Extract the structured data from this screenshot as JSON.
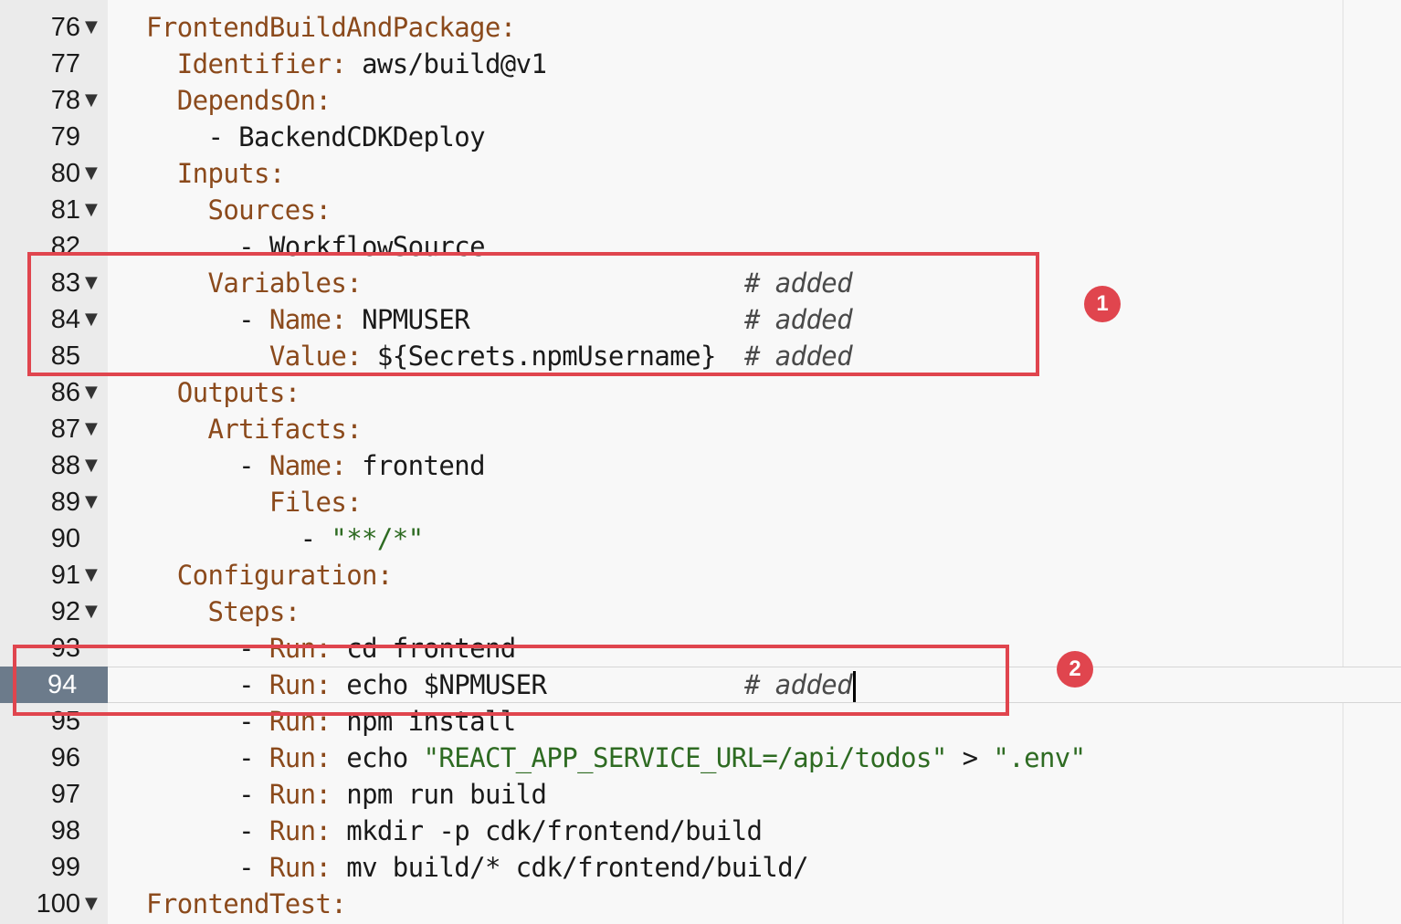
{
  "editor": {
    "fold_glyph": "▼",
    "active_line": "94",
    "lines": [
      {
        "num": "76",
        "fold": true,
        "indent": "",
        "key": "FrontendBuildAndPackage:",
        "value": "",
        "value_kind": "",
        "comment": ""
      },
      {
        "num": "77",
        "fold": false,
        "indent": "  ",
        "key": "Identifier:",
        "value": " aws/build@v1",
        "value_kind": "",
        "comment": ""
      },
      {
        "num": "78",
        "fold": true,
        "indent": "  ",
        "key": "DependsOn:",
        "value": "",
        "value_kind": "",
        "comment": ""
      },
      {
        "num": "79",
        "fold": false,
        "indent": "    - ",
        "key": "",
        "value": "BackendCDKDeploy",
        "value_kind": "",
        "comment": ""
      },
      {
        "num": "80",
        "fold": true,
        "indent": "  ",
        "key": "Inputs:",
        "value": "",
        "value_kind": "",
        "comment": ""
      },
      {
        "num": "81",
        "fold": true,
        "indent": "    ",
        "key": "Sources:",
        "value": "",
        "value_kind": "",
        "comment": ""
      },
      {
        "num": "82",
        "fold": false,
        "indent": "      - ",
        "key": "",
        "value": "WorkflowSource",
        "value_kind": "",
        "comment": ""
      },
      {
        "num": "83",
        "fold": true,
        "indent": "    ",
        "key": "Variables:",
        "value": "",
        "value_kind": "",
        "comment": "# added"
      },
      {
        "num": "84",
        "fold": true,
        "indent": "      - ",
        "key": "Name:",
        "value": " NPMUSER",
        "value_kind": "",
        "comment": "# added"
      },
      {
        "num": "85",
        "fold": false,
        "indent": "        ",
        "key": "Value:",
        "value": " ${Secrets.npmUsername}",
        "value_kind": "",
        "comment": "# added"
      },
      {
        "num": "86",
        "fold": true,
        "indent": "  ",
        "key": "Outputs:",
        "value": "",
        "value_kind": "",
        "comment": ""
      },
      {
        "num": "87",
        "fold": true,
        "indent": "    ",
        "key": "Artifacts:",
        "value": "",
        "value_kind": "",
        "comment": ""
      },
      {
        "num": "88",
        "fold": true,
        "indent": "      - ",
        "key": "Name:",
        "value": " frontend",
        "value_kind": "",
        "comment": ""
      },
      {
        "num": "89",
        "fold": true,
        "indent": "        ",
        "key": "Files:",
        "value": "",
        "value_kind": "",
        "comment": ""
      },
      {
        "num": "90",
        "fold": false,
        "indent": "          - ",
        "key": "",
        "value": "\"**/*\"",
        "value_kind": "string",
        "comment": ""
      },
      {
        "num": "91",
        "fold": true,
        "indent": "  ",
        "key": "Configuration:",
        "value": "",
        "value_kind": "",
        "comment": ""
      },
      {
        "num": "92",
        "fold": true,
        "indent": "    ",
        "key": "Steps:",
        "value": "",
        "value_kind": "",
        "comment": ""
      },
      {
        "num": "93",
        "fold": false,
        "indent": "      - ",
        "key": "Run:",
        "value": " cd frontend",
        "value_kind": "",
        "comment": ""
      },
      {
        "num": "94",
        "fold": false,
        "indent": "      - ",
        "key": "Run:",
        "value": " echo $NPMUSER",
        "value_kind": "",
        "comment": "# added"
      },
      {
        "num": "95",
        "fold": false,
        "indent": "      - ",
        "key": "Run:",
        "value": " npm install",
        "value_kind": "",
        "comment": ""
      },
      {
        "num": "96",
        "fold": false,
        "indent": "      - ",
        "key": "Run:",
        "value": " echo ",
        "value_kind": "mixed96",
        "comment": ""
      },
      {
        "num": "97",
        "fold": false,
        "indent": "      - ",
        "key": "Run:",
        "value": " npm run build",
        "value_kind": "",
        "comment": ""
      },
      {
        "num": "98",
        "fold": false,
        "indent": "      - ",
        "key": "Run:",
        "value": " mkdir -p cdk/frontend/build",
        "value_kind": "",
        "comment": ""
      },
      {
        "num": "99",
        "fold": false,
        "indent": "      - ",
        "key": "Run:",
        "value": " mv build/* cdk/frontend/build/",
        "value_kind": "",
        "comment": ""
      },
      {
        "num": "100",
        "fold": true,
        "indent": "",
        "key": "FrontendTest:",
        "value": "",
        "value_kind": "",
        "comment": ""
      }
    ],
    "line96_parts": {
      "str1": "\"REACT_APP_SERVICE_URL=/api/todos\"",
      "op": " > ",
      "str2": "\".env\""
    }
  },
  "annotations": {
    "badge1": "1",
    "badge2": "2",
    "accent_color": "#e0454e"
  }
}
